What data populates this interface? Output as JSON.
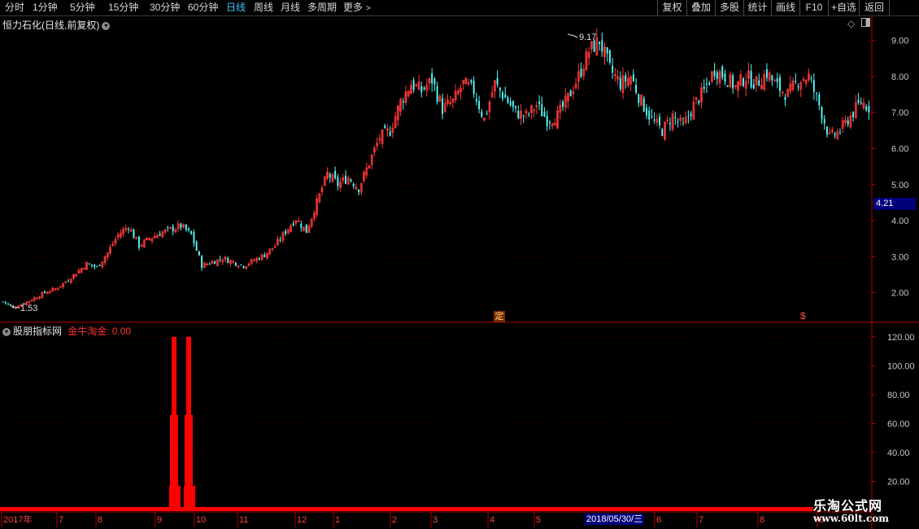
{
  "toolbar": {
    "periods": [
      "分时",
      "1分钟",
      "5分钟",
      "15分钟",
      "30分钟",
      "60分钟",
      "日线",
      "周线",
      "月线",
      "多周期"
    ],
    "active": "日线",
    "more": "更多",
    "buttons": [
      "复权",
      "叠加",
      "多股",
      "统计",
      "画线",
      "F10",
      "+自选",
      "返回"
    ]
  },
  "stock": {
    "title": "恒力石化(日线,前复权)",
    "current_price_label": "4.21",
    "high_label": "9.17",
    "low_label": "1.53",
    "event_markers": [
      "定",
      "$"
    ]
  },
  "indicator": {
    "name": "股朋指标网",
    "formula": "金牛淘金:",
    "value": "0.00"
  },
  "xaxis": {
    "labels": [
      "2017年",
      "7",
      "8",
      "9",
      "10",
      "11",
      "12",
      "1",
      "2",
      "3",
      "4",
      "5",
      "6",
      "7",
      "8",
      "9"
    ],
    "cursor_date": "2018/05/30/三"
  },
  "watermark": {
    "site_name": "乐淘公式网",
    "url": "www.60lt.com"
  },
  "colors": {
    "up": "#ff3838",
    "down": "#54fcfc",
    "axis": "#b00000",
    "grid": "#5a0000",
    "indicator": "#ff0000",
    "active_tab": "#3ec6ff"
  },
  "chart_data": [
    {
      "type": "candlestick",
      "title": "恒力石化(日线,前复权)",
      "ylim": [
        1.2,
        9.4
      ],
      "yticks": [
        2.0,
        3.0,
        4.0,
        5.0,
        6.0,
        7.0,
        8.0,
        9.0
      ],
      "grid": true,
      "annotations": [
        {
          "text": "9.17",
          "type": "high",
          "value": 9.17
        },
        {
          "text": "1.53",
          "type": "low",
          "value": 1.53
        },
        {
          "text": "4.21",
          "type": "current-price",
          "value": 4.21
        }
      ],
      "close_trend": [
        1.75,
        1.6,
        1.7,
        1.85,
        2.0,
        2.1,
        2.3,
        2.55,
        2.8,
        2.7,
        3.1,
        3.6,
        3.85,
        3.3,
        3.5,
        3.65,
        3.75,
        3.85,
        3.6,
        2.75,
        2.85,
        2.95,
        2.85,
        2.75,
        2.9,
        3.05,
        3.3,
        3.7,
        4.05,
        3.7,
        4.5,
        5.3,
        5.0,
        5.2,
        4.9,
        5.6,
        6.3,
        6.5,
        7.3,
        7.8,
        7.6,
        7.9,
        7.1,
        7.3,
        7.8,
        7.6,
        6.8,
        7.8,
        7.4,
        7.0,
        6.9,
        7.2,
        6.8,
        6.9,
        7.4,
        8.0,
        8.7,
        9.0,
        8.2,
        7.8,
        8.0,
        7.3,
        6.8,
        6.5,
        6.9,
        6.6,
        7.2,
        7.6,
        8.2,
        8.0,
        7.7,
        8.0,
        7.8,
        8.1,
        7.7,
        7.5,
        7.9,
        8.0,
        7.2,
        6.3,
        6.5,
        6.9,
        7.3,
        7.1
      ]
    },
    {
      "type": "line",
      "title": "金牛淘金",
      "ylim": [
        0,
        125
      ],
      "yticks": [
        20.0,
        40.0,
        60.0,
        80.0,
        100.0,
        120.0
      ],
      "grid": true,
      "series": [
        {
          "name": "金牛淘金",
          "spikes": [
            120,
            120
          ],
          "baseline": 0
        }
      ]
    }
  ]
}
